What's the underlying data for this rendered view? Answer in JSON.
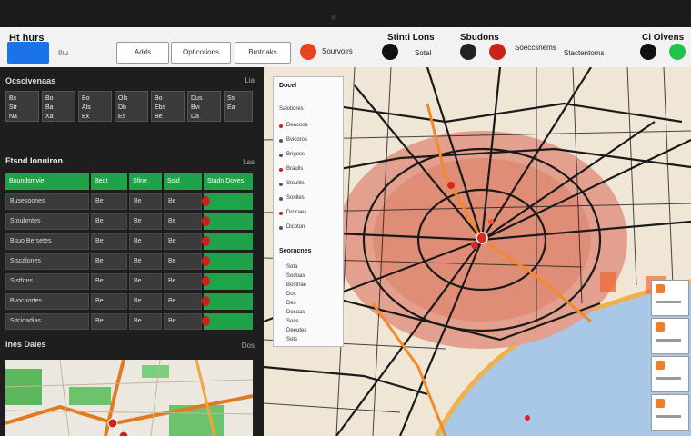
{
  "topbar": {
    "brand": "Ht hurs",
    "brand_sub": "Ihu",
    "nav_buttons": [
      "Adds",
      "Opticotions",
      "Brotnaks"
    ],
    "status_title_1": "Stinti Lons",
    "status_title_2": "Sbudons",
    "status_title_3": "Ci Olvens",
    "status_labels": [
      "Sourvoirs",
      "Sotal",
      "Soeccsnems",
      "Stactentoms"
    ]
  },
  "left": {
    "section1_title": "Ocscivenaas",
    "section1_icon": "Lia",
    "tiles": [
      "Bs\nStr\nNa",
      "Bo\nBa\nXa",
      "Bo\nAls\nEx",
      "Ols\nDb\nEs",
      "Bo\nEbs\nBe",
      "Dus\nBvi\nDa",
      "Ss\nEa"
    ],
    "section2_title": "Ftsnd Ionuiron",
    "section2_icon": "Las",
    "grid_header": [
      "Boundsmvie",
      "Bedt",
      "Sfine",
      "Ssld",
      "Stadn Doves"
    ],
    "grid_rows": [
      [
        "Busesoones",
        "Be",
        "Be",
        "Be",
        ""
      ],
      [
        "Stoubmtes",
        "Be",
        "Be",
        "Be",
        ""
      ],
      [
        "Bsuo Bersetes",
        "Be",
        "Be",
        "Be",
        ""
      ],
      [
        "Siscalones",
        "Be",
        "Be",
        "Be",
        ""
      ],
      [
        "Sistfons",
        "Be",
        "Be",
        "Be",
        ""
      ],
      [
        "Bvocnortes",
        "Be",
        "Be",
        "Be",
        ""
      ],
      [
        "Sitcidadias",
        "Be",
        "Be",
        "Be",
        ""
      ]
    ],
    "section3_title": "Ines Dales",
    "section3_icon": "Dos"
  },
  "list": {
    "title": "Docel",
    "subtitle": "Salotiores",
    "items": [
      "Deacoce",
      "Bvicoros",
      "Brigess",
      "Braulis",
      "Stoulits",
      "Sonlles",
      "Drocaes",
      "Dicoton"
    ],
    "head2": "Seoracnes",
    "items2": [
      "Sota",
      "Sodoas",
      "Bostriae",
      "Dos",
      "Des",
      "Dosaas",
      "Sons",
      "Deeutes",
      "Sots"
    ]
  },
  "colors": {
    "accent_green": "#1fa34a",
    "alert_red": "#c9231c",
    "nav_blue": "#1a73e8"
  }
}
